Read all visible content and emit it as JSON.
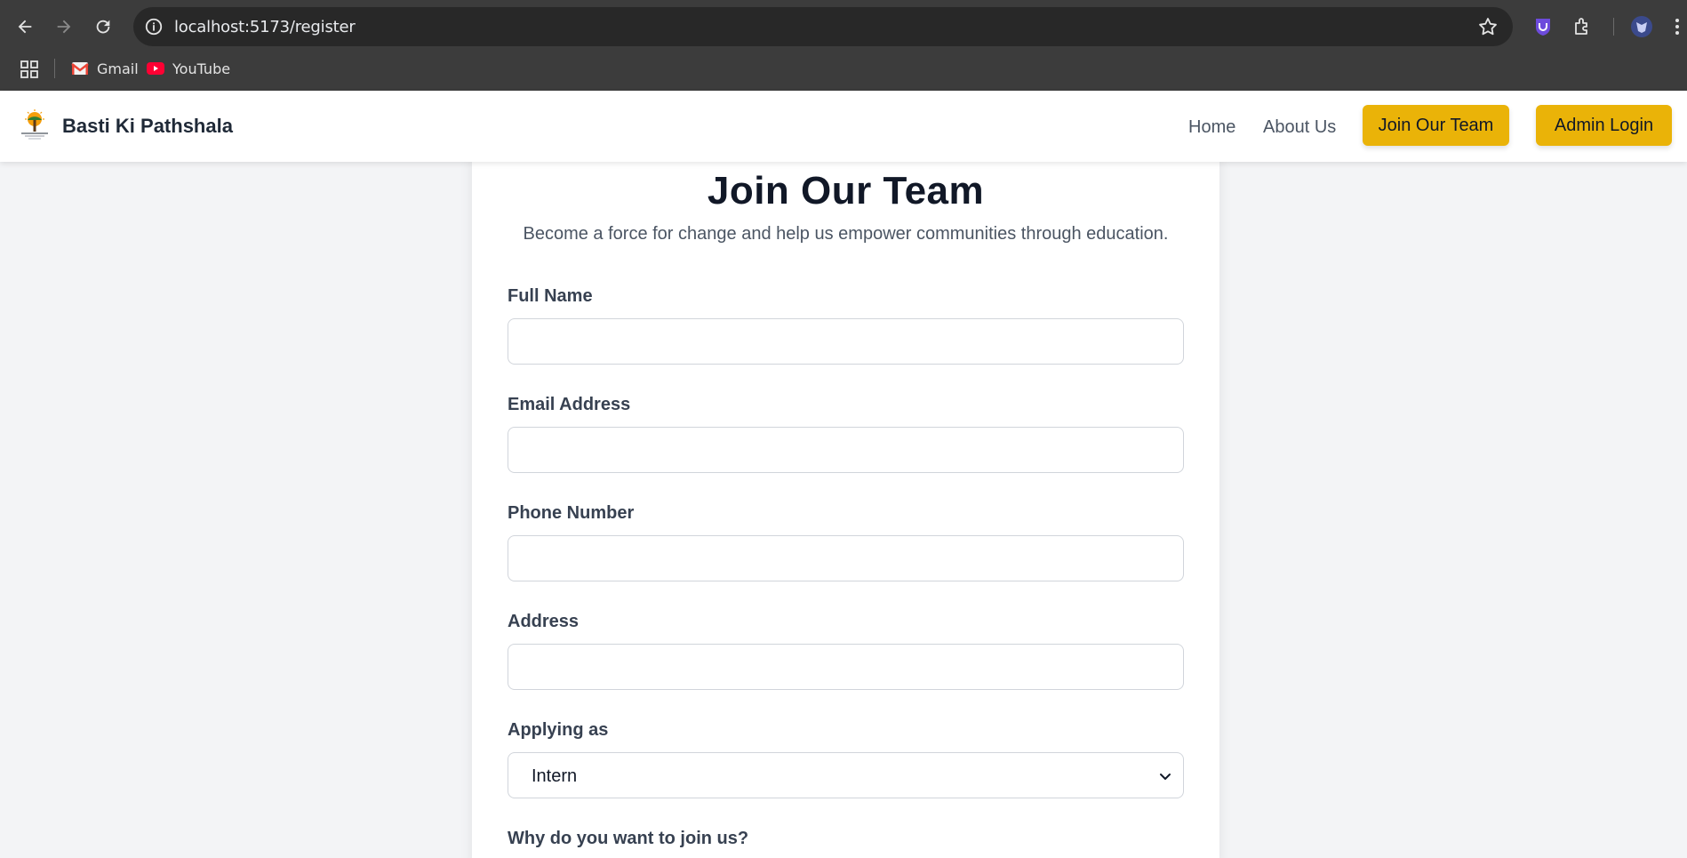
{
  "browser": {
    "url": "localhost:5173/register",
    "bookmarks": [
      {
        "label": "Gmail",
        "icon": "gmail-icon"
      },
      {
        "label": "YouTube",
        "icon": "youtube-icon"
      }
    ]
  },
  "header": {
    "brand": "Basti Ki Pathshala",
    "nav": {
      "home": "Home",
      "about": "About Us",
      "join": "Join Our Team",
      "admin": "Admin Login"
    }
  },
  "form": {
    "title": "Join Our Team",
    "subtitle": "Become a force for change and help us empower communities through education.",
    "full_name_label": "Full Name",
    "email_label": "Email Address",
    "phone_label": "Phone Number",
    "address_label": "Address",
    "applying_as_label": "Applying as",
    "applying_as_value": "Intern",
    "why_join_label": "Why do you want to join us?"
  },
  "colors": {
    "accent": "#eab308",
    "chrome_bg": "#3c3c3c",
    "page_bg": "#f3f4f6"
  }
}
